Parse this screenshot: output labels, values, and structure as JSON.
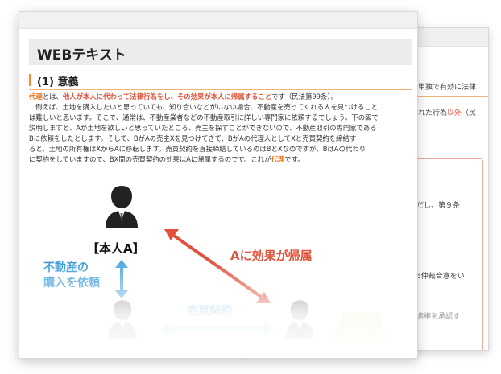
{
  "front": {
    "title": "WEBテキスト",
    "section_heading": "(1) 意義",
    "line1": {
      "a": "代理",
      "b": "とは、",
      "c": "他人が本人に代わって法律行為をし、その効果が本人に帰属すること",
      "d": "です（民法第99条）。"
    },
    "paragraph_lines": [
      "例えば、土地を購入したいと思っていても、知り合いなどがいない場合、不動産を売ってくれる人を見つけること",
      "は難しいと思います。そこで、通常は、不動産業者などの不動産取引に詳しい専門家に依頼するでしょう。下の図で",
      "説明しますと、Aが土地を欲しいと思っていたところ、売主を探すことができないので、不動産取引の専門家である",
      "Bに依頼をしたとします。そして、BがAの売主Xを見つけてきて、BがAの代理人としてXと売買契約を締結す",
      "ると、土地の所有権はXからAに移転します。売買契約を直接締結しているのはBとXなのですが、BはAの代わり"
    ],
    "last_line": {
      "a": "に契約をしていますので、BX間の売買契約の効果はAに帰属するのです。これが",
      "b": "代理",
      "c": "です。"
    },
    "diagram": {
      "principal_label": "【本人A】",
      "request_label_1": "不動産の",
      "request_label_2": "購入を依頼",
      "effect_label": "Aに効果が帰属",
      "contract_label": "売買契約"
    }
  },
  "back": {
    "lines": [
      {
        "a": "単独で有効に法律",
        "b": ""
      },
      {
        "a": "れた行為",
        "b": "以外",
        "c": "（民"
      }
    ],
    "box_lines": [
      "だし、第９条",
      "5仲裁合意をい",
      "適権を承認す"
    ]
  },
  "colors": {
    "accent_orange": "#f08a2d",
    "accent_red": "#e2523b",
    "accent_blue": "#3a9ad9",
    "light_blue": "#8cc6ec"
  }
}
